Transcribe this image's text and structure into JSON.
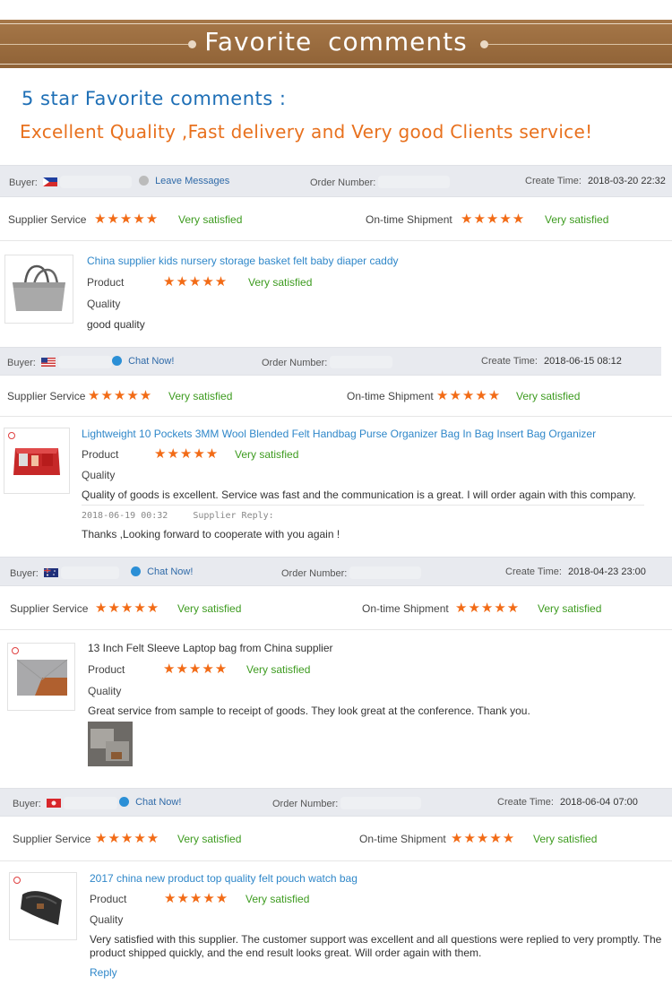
{
  "banner": {
    "title": "Favorite  comments"
  },
  "heading": "5 star Favorite comments :",
  "subheading": "Excellent Quality ,Fast delivery and Very good Clients service!",
  "colors": {
    "banner": "#9a6c3e",
    "heading": "#1e6fb6",
    "subheading": "#e8711e",
    "star": "#f26b16",
    "satisfied": "#3d9b1f",
    "link": "#2f87c9"
  },
  "labels": {
    "buyer": "Buyer:",
    "order_number": "Order Number:",
    "create_time": "Create Time:",
    "supplier_service": "Supplier Service",
    "ontime_shipment": "On-time Shipment",
    "product": "Product",
    "quality": "Quality",
    "very_satisfied": "Very satisfied",
    "stars": "★★★★★",
    "rating_value": 5,
    "rating_max": 5
  },
  "reviews": [
    {
      "flag": "philippines-flag",
      "chat_label": "Leave Messages",
      "create_time": "2018-03-20 22:32",
      "product_name": "China supplier kids nursery storage basket felt baby diaper caddy",
      "comment": "good quality"
    },
    {
      "flag": "us-flag",
      "chat_label": "Chat Now!",
      "create_time": "2018-06-15 08:12",
      "product_name": "Lightweight 10 Pockets 3MM Wool Blended Felt Handbag Purse Organizer Bag In Bag Insert Bag Organizer",
      "comment": "Quality of goods is excellent. Service was fast and the communication is a great. I will order again with this company.",
      "reply_time": "2018-06-19 00:32",
      "reply_label": "Supplier Reply:",
      "reply_text": "Thanks ,Looking forward to cooperate with you again !"
    },
    {
      "flag": "australia-flag",
      "chat_label": "Chat Now!",
      "create_time": "2018-04-23 23:00",
      "product_name": "13 Inch Felt Sleeve Laptop bag from China supplier",
      "comment": "Great service from sample to receipt of goods. They look great at the conference. Thank you."
    },
    {
      "flag": "hong-kong-flag",
      "chat_label": "Chat Now!",
      "create_time": "2018-06-04 07:00",
      "product_name": "2017 china new product top quality felt pouch watch bag",
      "comment": "Very satisfied with this supplier. The customer support was excellent and all questions were replied to very promptly. The product shipped quickly, and the end result looks great. Will order again with them.",
      "reply_link": "Reply"
    }
  ]
}
